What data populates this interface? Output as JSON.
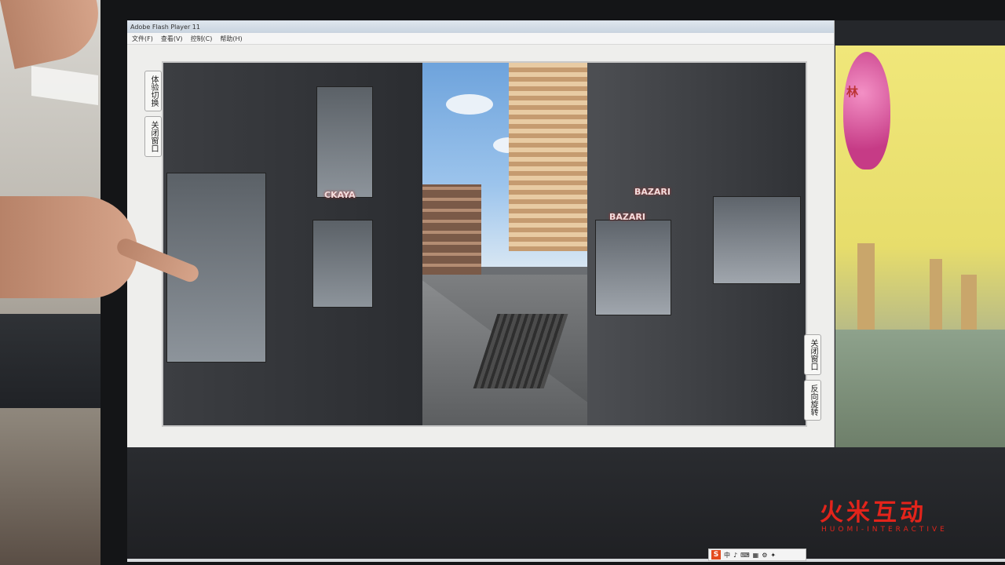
{
  "window": {
    "title": "Adobe Flash Player 11",
    "menu": [
      "文件(F)",
      "查看(V)",
      "控制(C)",
      "帮助(H)"
    ]
  },
  "side_buttons": {
    "left": [
      "体验切换",
      "关闭窗口"
    ],
    "right": [
      "关闭窗口",
      "反向旋转"
    ]
  },
  "scene_signs": {
    "left_shop": "CKAYA",
    "right_shop": "BAZARI",
    "right_top": "BAZARI"
  },
  "ad": {
    "text": "林"
  },
  "tray": {
    "icon": "S",
    "items": [
      "中",
      "♪",
      "⌨",
      "▦",
      "⚙",
      "✦"
    ]
  },
  "watermark": {
    "logo": "火米互动",
    "sub": "HUOMI-INTERACTIVE"
  },
  "colors": {
    "accent": "#e3241b",
    "window_bg": "#eeeeec"
  }
}
